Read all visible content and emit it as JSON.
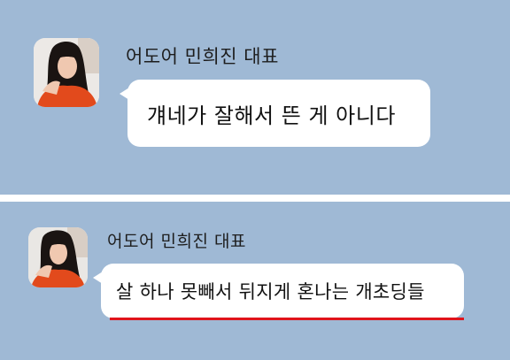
{
  "messages": [
    {
      "sender": "어도어 민희진 대표",
      "text": "걔네가 잘해서 뜬 게 아니다",
      "avatar_icon": "profile-photo"
    },
    {
      "sender": "어도어 민희진 대표",
      "text": "살 하나 못빼서 뒤지게 혼나는 개초딩들",
      "avatar_icon": "profile-photo",
      "underline_color": "#e0141b"
    }
  ],
  "colors": {
    "chat_background": "#9fb9d5",
    "bubble": "#ffffff",
    "divider": "#ffffff"
  }
}
